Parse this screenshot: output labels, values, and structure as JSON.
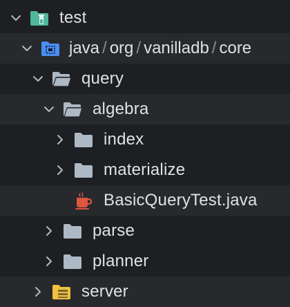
{
  "tree": {
    "rows": [
      {
        "label": "test",
        "icon": "test-folder-icon",
        "expanded": true,
        "depth": 0
      },
      {
        "segments": [
          "java",
          "org",
          "vanilladb",
          "core"
        ],
        "separator": "/",
        "icon": "package-folder-icon",
        "expanded": true,
        "depth": 1
      },
      {
        "label": "query",
        "icon": "folder-open-icon",
        "expanded": true,
        "depth": 2
      },
      {
        "label": "algebra",
        "icon": "folder-open-icon",
        "expanded": true,
        "depth": 3
      },
      {
        "label": "index",
        "icon": "folder-icon",
        "expanded": false,
        "depth": 4
      },
      {
        "label": "materialize",
        "icon": "folder-icon",
        "expanded": false,
        "depth": 4
      },
      {
        "label": "BasicQueryTest.java",
        "icon": "java-test-icon",
        "depth": 4
      },
      {
        "label": "parse",
        "icon": "folder-icon",
        "expanded": false,
        "depth": 3
      },
      {
        "label": "planner",
        "icon": "folder-icon",
        "expanded": false,
        "depth": 3
      },
      {
        "label": "server",
        "icon": "server-folder-icon",
        "expanded": false,
        "depth": 2
      }
    ]
  },
  "colors": {
    "background": "#1e1f22",
    "row_alt": "#27292d",
    "text": "#dfe1e5",
    "chevron": "#b4b8bf",
    "folder": "#aeb9c6",
    "test_folder": "#4fb79b",
    "package_folder": "#4a8ef0",
    "java_test": "#e0553f",
    "server_folder": "#f0c040"
  }
}
